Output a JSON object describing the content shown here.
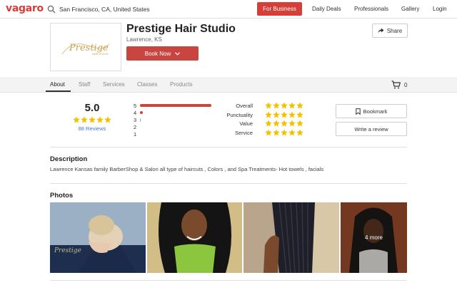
{
  "header": {
    "logo": "vagaro",
    "search_value": "San Francisco, CA, United States",
    "for_business": "For Business",
    "nav": [
      "Daily Deals",
      "Professionals",
      "Gallery",
      "Login"
    ]
  },
  "business": {
    "name": "Prestige Hair Studio",
    "location": "Lawrence, KS",
    "book_now": "Book Now",
    "share": "Share",
    "logo_text": "Prestige",
    "logo_subtext": "HAIR STUDIO"
  },
  "tabs": [
    "About",
    "Staff",
    "Services",
    "Classes",
    "Products"
  ],
  "cart_count": "0",
  "ratings": {
    "score": "5.0",
    "reviews_link": "88 Reviews",
    "distribution": [
      {
        "label": "5",
        "fraction": 1.0
      },
      {
        "label": "4",
        "fraction": 0.04
      },
      {
        "label": "3",
        "fraction": 0.01
      },
      {
        "label": "2",
        "fraction": 0.0
      },
      {
        "label": "1",
        "fraction": 0.0
      }
    ],
    "categories": [
      {
        "label": "Overall",
        "stars": 5
      },
      {
        "label": "Punctuality",
        "stars": 5
      },
      {
        "label": "Value",
        "stars": 5
      },
      {
        "label": "Service",
        "stars": 5
      }
    ],
    "bookmark": "Bookmark",
    "write_review": "Write a review"
  },
  "description": {
    "title": "Description",
    "text": "Lawrence Kansas family BarberShop & Salon all type of haircuts , Colors , and Spa Treatments- Hot towels , facials"
  },
  "photos": {
    "title": "Photos",
    "more_label": "4 more"
  },
  "colors": {
    "brand_red": "#d43f3a",
    "star_yellow": "#f2c200",
    "link_blue": "#3a7bd5"
  }
}
